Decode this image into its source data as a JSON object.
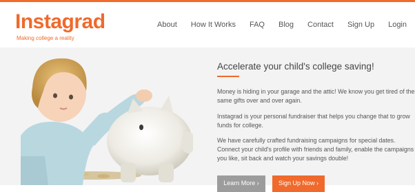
{
  "brand": {
    "name": "Instagrad",
    "tagline": "Making college a reality",
    "accent_color": "#ef6a2c"
  },
  "nav": {
    "items": [
      "About",
      "How It Works",
      "FAQ",
      "Blog",
      "Contact",
      "Sign Up",
      "Login"
    ]
  },
  "hero": {
    "headline": "Accelerate your child's college saving!",
    "paragraphs": [
      "Money is hiding in your garage and the attic! We know you get tired of the same gifts over and over again.",
      "Instagrad is your personal fundraiser that helps you change that to grow funds for college.",
      "We have carefully crafted fundraising campaigns for special dates. Connect your child's profile with friends and family, enable the campaigns you like, sit back and watch your savings double!"
    ],
    "buttons": {
      "learn_more": "Learn More ›",
      "sign_up_now": "Sign Up Now ›"
    },
    "image_icon": "child-with-piggy-bank-photo"
  }
}
